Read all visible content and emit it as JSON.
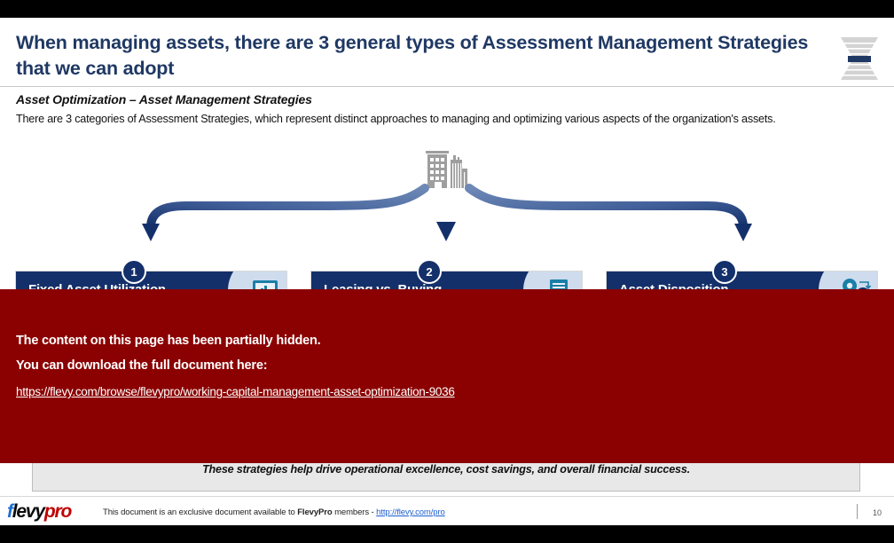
{
  "header": {
    "title": "When managing assets, there are 3 general types of Assessment Management Strategies that we can adopt",
    "logo_mark_name": "flevy-spool-logo"
  },
  "section": {
    "subtitle": "Asset Optimization – Asset Management Strategies",
    "lead": "There are 3 categories of Assessment Strategies, which represent distinct approaches to managing and optimizing various aspects of the organization's assets."
  },
  "diagram": {
    "source_icon": "office-buildings-icon",
    "arrows": [
      "curve-left-arrow",
      "down-arrow",
      "curve-right-arrow"
    ]
  },
  "cards": [
    {
      "number": "1",
      "title": "Fixed Asset Utilization",
      "icon": "monitor-analytics-icon"
    },
    {
      "number": "2",
      "title": "Leasing vs. Buying",
      "icon": "contract-signature-icon"
    },
    {
      "number": "3",
      "title": "Asset Disposition",
      "icon": "location-pins-icon"
    }
  ],
  "summary": {
    "text": "These strategies help drive operational excellence, cost savings, and overall financial success."
  },
  "overlay": {
    "line1": "The content on this page has been partially hidden.",
    "line2": "You can download the full document here:",
    "link": "https://flevy.com/browse/flevypro/working-capital-management-asset-optimization-9036",
    "color": "#8B0000"
  },
  "footer": {
    "logo_f": "f",
    "logo_levy": "levy",
    "logo_pro": "pro",
    "note_pre": "This document is an exclusive document available to ",
    "note_brand": "FlevyPro",
    "note_mid": " members - ",
    "note_link": "http://flevy.com/pro",
    "page": "10"
  },
  "colors": {
    "title_navy": "#1F3864",
    "card_navy": "#14306b",
    "arrow_light": "#6b86b4",
    "arrow_dark": "#13306b",
    "overlay_red": "#8B0000",
    "icon_grey": "#9e9e9e",
    "icon_teal": "#1a7fa8"
  }
}
